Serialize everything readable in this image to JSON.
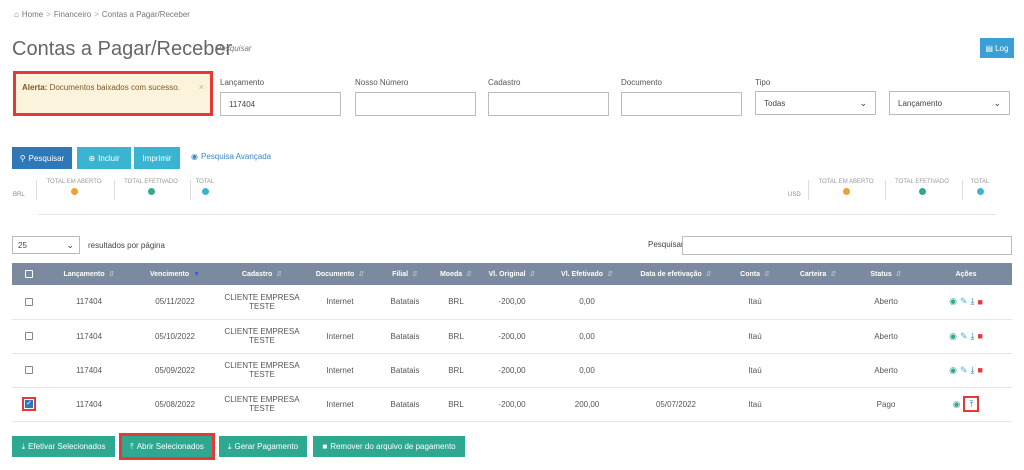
{
  "breadcrumb": {
    "home": "Home",
    "sep": ">",
    "level1": "Financeiro",
    "level2": "Contas a Pagar/Receber"
  },
  "header": {
    "title": "Contas a Pagar/Receber",
    "link": "Pesquisar",
    "log_label": "Log"
  },
  "alert": {
    "strong": "Alerta:",
    "message": "Documentos baixados com sucesso.",
    "close": "×"
  },
  "filters": {
    "lancamento_label": "Lançamento",
    "lancamento_value": "117404",
    "nosso_numero_label": "Nosso Número",
    "nosso_numero_value": "",
    "cadastro_label": "Cadastro",
    "cadastro_value": "",
    "documento_label": "Documento",
    "documento_value": "",
    "tipo_label": "Tipo",
    "tipo_value": "Todas",
    "order_value": "Lançamento"
  },
  "toolbar": {
    "pesquisar": "Pesquisar",
    "incluir": "Incluir",
    "imprimir": "Imprimir",
    "pesquisa_avancada": "Pesquisa Avançada"
  },
  "totals": {
    "brl": "BRL",
    "usd": "USD",
    "aberto": "TOTAL EM ABERTO",
    "efetivado": "TOTAL EFETIVADO",
    "total": "TOTAL"
  },
  "list": {
    "page_size": "25",
    "per_page_label": "resultados por página",
    "search_label": "Pesquisar"
  },
  "table": {
    "headers": [
      "Lançamento",
      "Vencimento",
      "Cadastro",
      "Documento",
      "Filial",
      "Moeda",
      "Vl. Original",
      "Vl. Efetivado",
      "Data de efetivação",
      "Conta",
      "Carteira",
      "Status",
      "Ações"
    ],
    "rows": [
      {
        "lancamento": "117404",
        "vencimento": "05/11/2022",
        "cadastro1": "CLIENTE EMPRESA",
        "cadastro2": "TESTE",
        "documento": "Internet",
        "filial": "Batatais",
        "moeda": "BRL",
        "original": "-200,00",
        "efetivado": "0,00",
        "data": "",
        "conta": "Itaú",
        "carteira": "",
        "status": "Aberto"
      },
      {
        "lancamento": "117404",
        "vencimento": "05/10/2022",
        "cadastro1": "CLIENTE EMPRESA",
        "cadastro2": "TESTE",
        "documento": "Internet",
        "filial": "Batatais",
        "moeda": "BRL",
        "original": "-200,00",
        "efetivado": "0,00",
        "data": "",
        "conta": "Itaú",
        "carteira": "",
        "status": "Aberto"
      },
      {
        "lancamento": "117404",
        "vencimento": "05/09/2022",
        "cadastro1": "CLIENTE EMPRESA",
        "cadastro2": "TESTE",
        "documento": "Internet",
        "filial": "Batatais",
        "moeda": "BRL",
        "original": "-200,00",
        "efetivado": "0,00",
        "data": "",
        "conta": "Itaú",
        "carteira": "",
        "status": "Aberto"
      },
      {
        "lancamento": "117404",
        "vencimento": "05/08/2022",
        "cadastro1": "CLIENTE EMPRESA",
        "cadastro2": "TESTE",
        "documento": "Internet",
        "filial": "Batatais",
        "moeda": "BRL",
        "original": "-200,00",
        "efetivado": "200,00",
        "data": "05/07/2022",
        "conta": "Itaú",
        "carteira": "",
        "status": "Pago"
      }
    ]
  },
  "bottom": {
    "efetivar": "Efetivar Selecionados",
    "abrir": "Abrir Selecionados",
    "gerar": "Gerar Pagamento",
    "remover": "Remover do arquivo de pagamento"
  },
  "colors": {
    "primary": "#2f78b8",
    "teal": "#3ab5d1",
    "green": "#2fa891",
    "header": "#7b8a9f",
    "highlight": "#e53935",
    "alert_bg": "#fcf3dc"
  }
}
